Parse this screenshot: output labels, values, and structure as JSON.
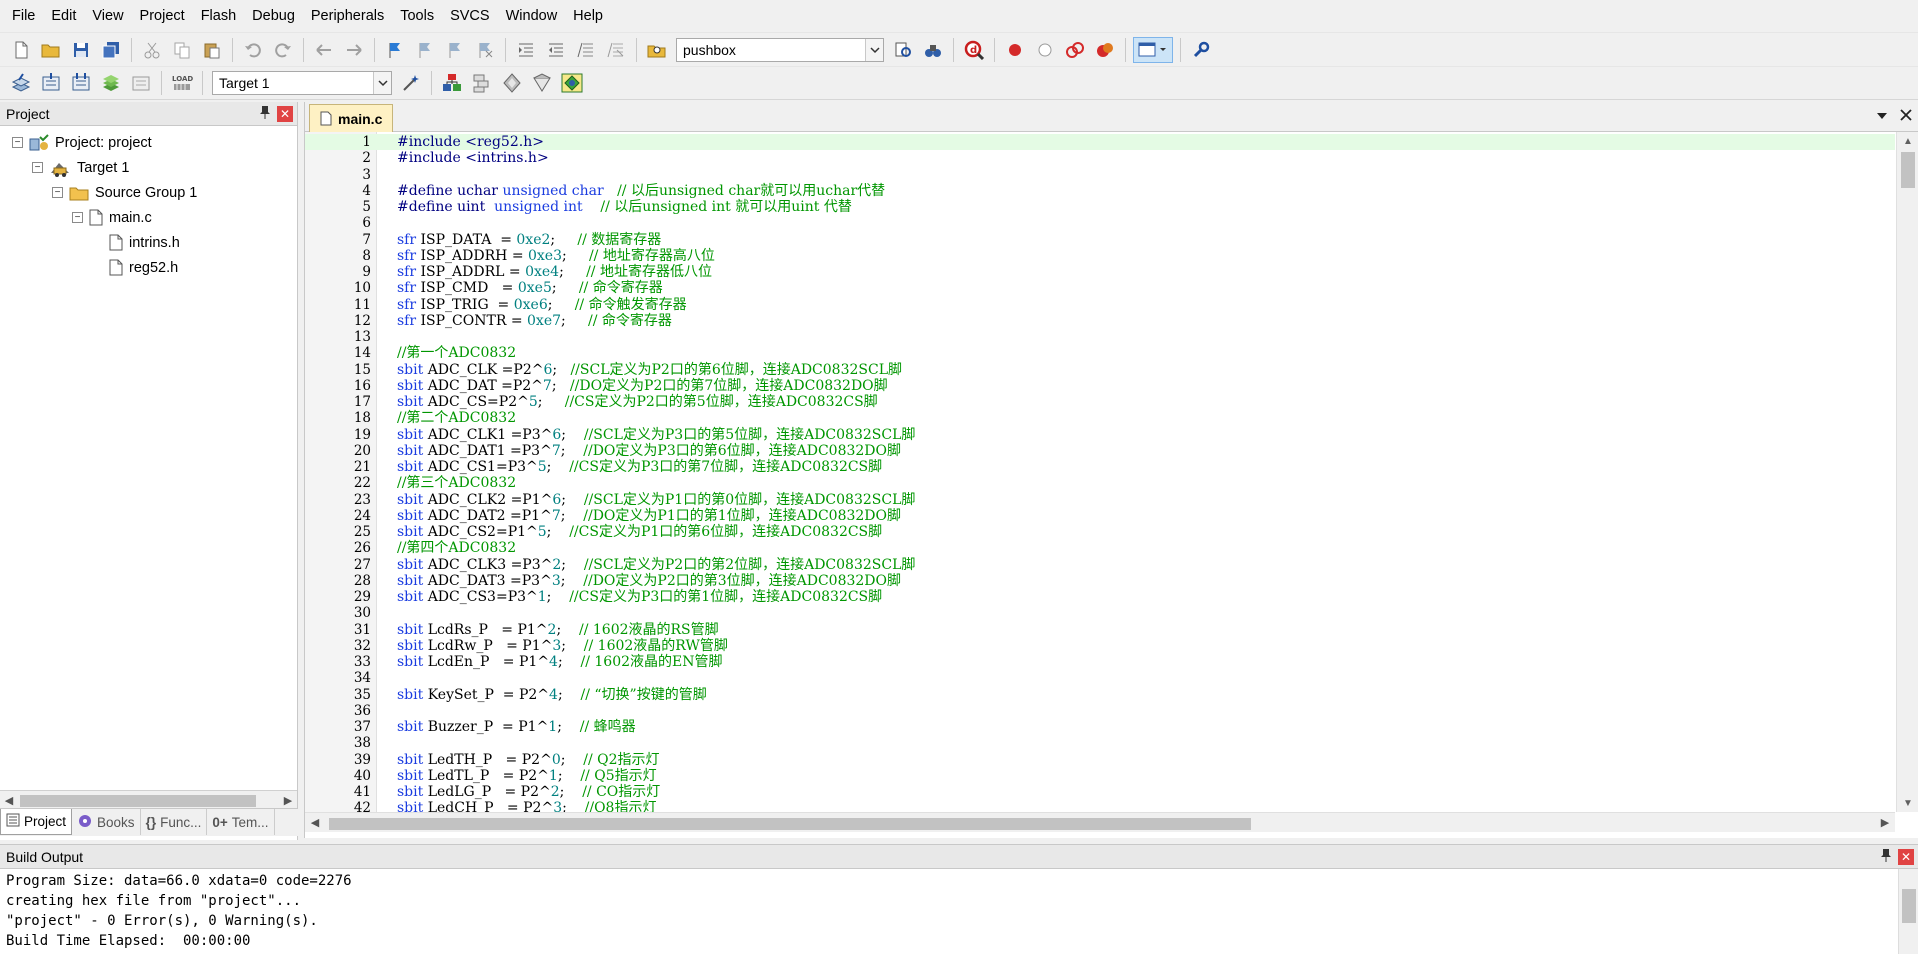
{
  "menubar": {
    "items": [
      "File",
      "Edit",
      "View",
      "Project",
      "Flash",
      "Debug",
      "Peripherals",
      "Tools",
      "SVCS",
      "Window",
      "Help"
    ]
  },
  "toolbar": {
    "find_combo_value": "pushbox",
    "target_combo_value": "Target 1"
  },
  "project_panel": {
    "title": "Project",
    "tree": [
      {
        "label": "Project: project",
        "level": 0,
        "icon": "project-icon",
        "expander": "−"
      },
      {
        "label": "Target 1",
        "level": 1,
        "icon": "target-icon",
        "expander": "−"
      },
      {
        "label": "Source Group 1",
        "level": 2,
        "icon": "folder-icon",
        "expander": "−"
      },
      {
        "label": "main.c",
        "level": 3,
        "icon": "file-icon",
        "expander": "−"
      },
      {
        "label": "intrins.h",
        "level": 4,
        "icon": "file-icon",
        "expander": ""
      },
      {
        "label": "reg52.h",
        "level": 4,
        "icon": "file-icon",
        "expander": ""
      }
    ],
    "tabs": [
      {
        "label": "Project",
        "icon": "project-tab-icon",
        "active": true
      },
      {
        "label": "Books",
        "icon": "books-icon",
        "active": false
      },
      {
        "label": "Func...",
        "icon": "{}",
        "active": false
      },
      {
        "label": "Tem...",
        "icon": "0+",
        "active": false
      }
    ]
  },
  "editor": {
    "active_file": "main.c",
    "lines": [
      {
        "n": "1",
        "tokens": [
          [
            "pre",
            "#include <reg52.h>"
          ]
        ]
      },
      {
        "n": "2",
        "tokens": [
          [
            "pre",
            "#include <intrins.h>"
          ]
        ]
      },
      {
        "n": "3",
        "tokens": []
      },
      {
        "n": "4",
        "tokens": [
          [
            "pre",
            "#define uchar "
          ],
          [
            "kw",
            "unsigned char"
          ],
          [
            "pl",
            "   "
          ],
          [
            "cmt",
            "// 以后unsigned char就可以用uchar代替"
          ]
        ]
      },
      {
        "n": "5",
        "tokens": [
          [
            "pre",
            "#define uint  "
          ],
          [
            "kw",
            "unsigned int"
          ],
          [
            "pl",
            "    "
          ],
          [
            "cmt",
            "// 以后unsigned int 就可以用uint 代替"
          ]
        ]
      },
      {
        "n": "6",
        "tokens": []
      },
      {
        "n": "7",
        "tokens": [
          [
            "kw",
            "sfr"
          ],
          [
            "pl",
            " ISP_DATA  = "
          ],
          [
            "num",
            "0xe2"
          ],
          [
            "pl",
            ";     "
          ],
          [
            "cmt",
            "// 数据寄存器"
          ]
        ]
      },
      {
        "n": "8",
        "tokens": [
          [
            "kw",
            "sfr"
          ],
          [
            "pl",
            " ISP_ADDRH = "
          ],
          [
            "num",
            "0xe3"
          ],
          [
            "pl",
            ";     "
          ],
          [
            "cmt",
            "// 地址寄存器高八位"
          ]
        ]
      },
      {
        "n": "9",
        "tokens": [
          [
            "kw",
            "sfr"
          ],
          [
            "pl",
            " ISP_ADDRL = "
          ],
          [
            "num",
            "0xe4"
          ],
          [
            "pl",
            ";     "
          ],
          [
            "cmt",
            "// 地址寄存器低八位"
          ]
        ]
      },
      {
        "n": "10",
        "tokens": [
          [
            "kw",
            "sfr"
          ],
          [
            "pl",
            " ISP_CMD   = "
          ],
          [
            "num",
            "0xe5"
          ],
          [
            "pl",
            ";     "
          ],
          [
            "cmt",
            "// 命令寄存器"
          ]
        ]
      },
      {
        "n": "11",
        "tokens": [
          [
            "kw",
            "sfr"
          ],
          [
            "pl",
            " ISP_TRIG  = "
          ],
          [
            "num",
            "0xe6"
          ],
          [
            "pl",
            ";     "
          ],
          [
            "cmt",
            "// 命令触发寄存器"
          ]
        ]
      },
      {
        "n": "12",
        "tokens": [
          [
            "kw",
            "sfr"
          ],
          [
            "pl",
            " ISP_CONTR = "
          ],
          [
            "num",
            "0xe7"
          ],
          [
            "pl",
            ";     "
          ],
          [
            "cmt",
            "// 命令寄存器"
          ]
        ]
      },
      {
        "n": "13",
        "tokens": []
      },
      {
        "n": "14",
        "tokens": [
          [
            "cmt",
            "//第一个ADC0832"
          ]
        ]
      },
      {
        "n": "15",
        "tokens": [
          [
            "kw",
            "sbit"
          ],
          [
            "pl",
            " ADC_CLK =P2^"
          ],
          [
            "num",
            "6"
          ],
          [
            "pl",
            ";   "
          ],
          [
            "cmt",
            "//SCL定义为P2口的第6位脚，连接ADC0832SCL脚"
          ]
        ]
      },
      {
        "n": "16",
        "tokens": [
          [
            "kw",
            "sbit"
          ],
          [
            "pl",
            " ADC_DAT =P2^"
          ],
          [
            "num",
            "7"
          ],
          [
            "pl",
            ";   "
          ],
          [
            "cmt",
            "//DO定义为P2口的第7位脚，连接ADC0832DO脚"
          ]
        ]
      },
      {
        "n": "17",
        "tokens": [
          [
            "kw",
            "sbit"
          ],
          [
            "pl",
            " ADC_CS=P2^"
          ],
          [
            "num",
            "5"
          ],
          [
            "pl",
            ";     "
          ],
          [
            "cmt",
            "//CS定义为P2口的第5位脚，连接ADC0832CS脚"
          ]
        ]
      },
      {
        "n": "18",
        "tokens": [
          [
            "cmt",
            "//第二个ADC0832"
          ]
        ]
      },
      {
        "n": "19",
        "tokens": [
          [
            "kw",
            "sbit"
          ],
          [
            "pl",
            " ADC_CLK1 =P3^"
          ],
          [
            "num",
            "6"
          ],
          [
            "pl",
            ";    "
          ],
          [
            "cmt",
            "//SCL定义为P3口的第5位脚，连接ADC0832SCL脚"
          ]
        ]
      },
      {
        "n": "20",
        "tokens": [
          [
            "kw",
            "sbit"
          ],
          [
            "pl",
            " ADC_DAT1 =P3^"
          ],
          [
            "num",
            "7"
          ],
          [
            "pl",
            ";    "
          ],
          [
            "cmt",
            "//DO定义为P3口的第6位脚，连接ADC0832DO脚"
          ]
        ]
      },
      {
        "n": "21",
        "tokens": [
          [
            "kw",
            "sbit"
          ],
          [
            "pl",
            " ADC_CS1=P3^"
          ],
          [
            "num",
            "5"
          ],
          [
            "pl",
            ";    "
          ],
          [
            "cmt",
            "//CS定义为P3口的第7位脚，连接ADC0832CS脚"
          ]
        ]
      },
      {
        "n": "22",
        "tokens": [
          [
            "cmt",
            "//第三个ADC0832"
          ]
        ]
      },
      {
        "n": "23",
        "tokens": [
          [
            "kw",
            "sbit"
          ],
          [
            "pl",
            " ADC_CLK2 =P1^"
          ],
          [
            "num",
            "6"
          ],
          [
            "pl",
            ";    "
          ],
          [
            "cmt",
            "//SCL定义为P1口的第0位脚，连接ADC0832SCL脚"
          ]
        ]
      },
      {
        "n": "24",
        "tokens": [
          [
            "kw",
            "sbit"
          ],
          [
            "pl",
            " ADC_DAT2 =P1^"
          ],
          [
            "num",
            "7"
          ],
          [
            "pl",
            ";    "
          ],
          [
            "cmt",
            "//DO定义为P1口的第1位脚，连接ADC0832DO脚"
          ]
        ]
      },
      {
        "n": "25",
        "tokens": [
          [
            "kw",
            "sbit"
          ],
          [
            "pl",
            " ADC_CS2=P1^"
          ],
          [
            "num",
            "5"
          ],
          [
            "pl",
            ";    "
          ],
          [
            "cmt",
            "//CS定义为P1口的第6位脚，连接ADC0832CS脚"
          ]
        ]
      },
      {
        "n": "26",
        "tokens": [
          [
            "cmt",
            "//第四个ADC0832"
          ]
        ]
      },
      {
        "n": "27",
        "tokens": [
          [
            "kw",
            "sbit"
          ],
          [
            "pl",
            " ADC_CLK3 =P3^"
          ],
          [
            "num",
            "2"
          ],
          [
            "pl",
            ";    "
          ],
          [
            "cmt",
            "//SCL定义为P2口的第2位脚，连接ADC0832SCL脚"
          ]
        ]
      },
      {
        "n": "28",
        "tokens": [
          [
            "kw",
            "sbit"
          ],
          [
            "pl",
            " ADC_DAT3 =P3^"
          ],
          [
            "num",
            "3"
          ],
          [
            "pl",
            ";    "
          ],
          [
            "cmt",
            "//DO定义为P2口的第3位脚，连接ADC0832DO脚"
          ]
        ]
      },
      {
        "n": "29",
        "tokens": [
          [
            "kw",
            "sbit"
          ],
          [
            "pl",
            " ADC_CS3=P3^"
          ],
          [
            "num",
            "1"
          ],
          [
            "pl",
            ";    "
          ],
          [
            "cmt",
            "//CS定义为P3口的第1位脚，连接ADC0832CS脚"
          ]
        ]
      },
      {
        "n": "30",
        "tokens": []
      },
      {
        "n": "31",
        "tokens": [
          [
            "kw",
            "sbit"
          ],
          [
            "pl",
            " LcdRs_P   = P1^"
          ],
          [
            "num",
            "2"
          ],
          [
            "pl",
            ";    "
          ],
          [
            "cmt",
            "// 1602液晶的RS管脚"
          ]
        ]
      },
      {
        "n": "32",
        "tokens": [
          [
            "kw",
            "sbit"
          ],
          [
            "pl",
            " LcdRw_P   = P1^"
          ],
          [
            "num",
            "3"
          ],
          [
            "pl",
            ";    "
          ],
          [
            "cmt",
            "// 1602液晶的RW管脚"
          ]
        ]
      },
      {
        "n": "33",
        "tokens": [
          [
            "kw",
            "sbit"
          ],
          [
            "pl",
            " LcdEn_P   = P1^"
          ],
          [
            "num",
            "4"
          ],
          [
            "pl",
            ";    "
          ],
          [
            "cmt",
            "// 1602液晶的EN管脚"
          ]
        ]
      },
      {
        "n": "34",
        "tokens": []
      },
      {
        "n": "35",
        "tokens": [
          [
            "kw",
            "sbit"
          ],
          [
            "pl",
            " KeySet_P  = P2^"
          ],
          [
            "num",
            "4"
          ],
          [
            "pl",
            ";    "
          ],
          [
            "cmt",
            "// “切换”按键的管脚"
          ]
        ]
      },
      {
        "n": "36",
        "tokens": []
      },
      {
        "n": "37",
        "tokens": [
          [
            "kw",
            "sbit"
          ],
          [
            "pl",
            " Buzzer_P  = P1^"
          ],
          [
            "num",
            "1"
          ],
          [
            "pl",
            ";    "
          ],
          [
            "cmt",
            "// 蜂鸣器"
          ]
        ]
      },
      {
        "n": "38",
        "tokens": []
      },
      {
        "n": "39",
        "tokens": [
          [
            "kw",
            "sbit"
          ],
          [
            "pl",
            " LedTH_P   = P2^"
          ],
          [
            "num",
            "0"
          ],
          [
            "pl",
            ";    "
          ],
          [
            "cmt",
            "// Q2指示灯"
          ]
        ]
      },
      {
        "n": "40",
        "tokens": [
          [
            "kw",
            "sbit"
          ],
          [
            "pl",
            " LedTL_P   = P2^"
          ],
          [
            "num",
            "1"
          ],
          [
            "pl",
            ";    "
          ],
          [
            "cmt",
            "// Q5指示灯"
          ]
        ]
      },
      {
        "n": "41",
        "tokens": [
          [
            "kw",
            "sbit"
          ],
          [
            "pl",
            " LedLG_P   = P2^"
          ],
          [
            "num",
            "2"
          ],
          [
            "pl",
            ";    "
          ],
          [
            "cmt",
            "// CO指示灯"
          ]
        ]
      },
      {
        "n": "42",
        "tokens": [
          [
            "kw",
            "sbit"
          ],
          [
            "pl",
            " LedCH_P   = P2^"
          ],
          [
            "num",
            "3"
          ],
          [
            "pl",
            ";    "
          ],
          [
            "cmt",
            "//Q8指示灯"
          ]
        ]
      }
    ]
  },
  "build_output": {
    "title": "Build Output",
    "lines": [
      "Program Size: data=66.0 xdata=0 code=2276",
      "creating hex file from \"project\"...",
      "\"project\" - 0 Error(s), 0 Warning(s).",
      "Build Time Elapsed:  00:00:00"
    ]
  },
  "colors": {
    "keyword": "#1a3ce0",
    "preprocessor": "#000080",
    "number": "#008080",
    "comment": "#009600",
    "current_line": "#e4fbe4",
    "tab_active": "#fef1c4"
  }
}
